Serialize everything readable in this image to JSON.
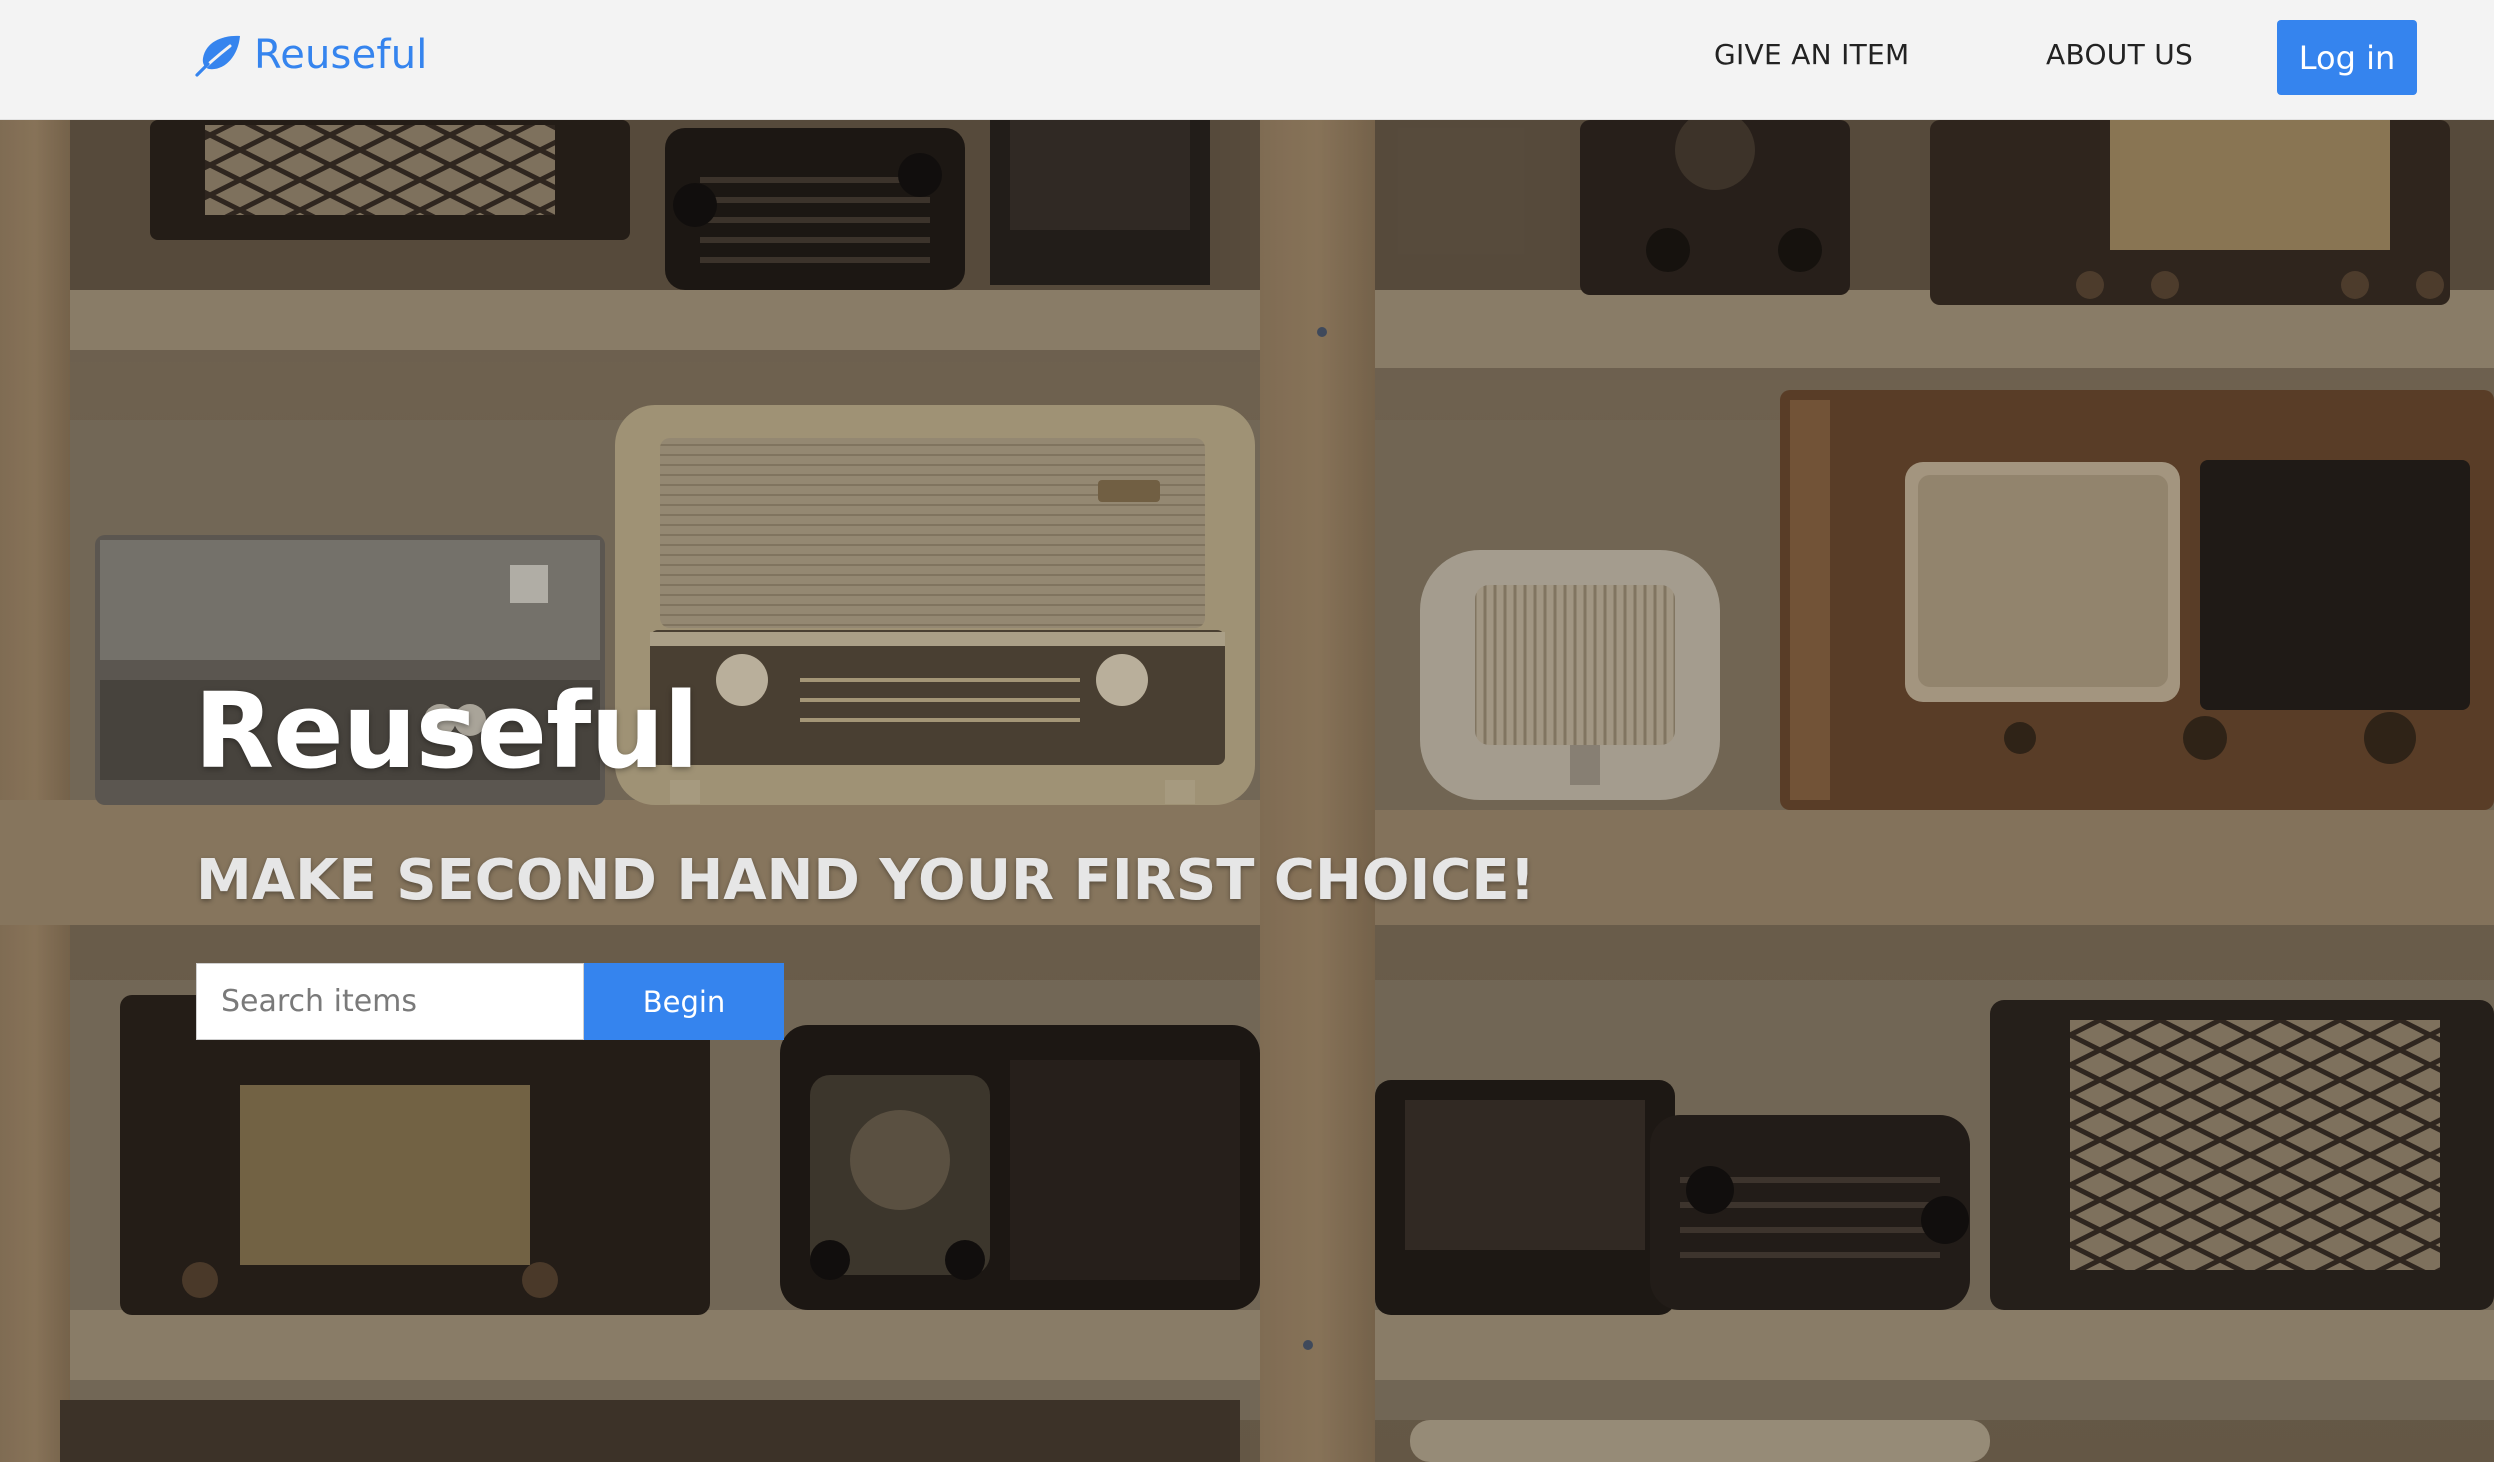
{
  "navbar": {
    "brand": "Reuseful",
    "brand_icon": "leaf-icon",
    "links": [
      "GIVE AN ITEM",
      "ABOUT US"
    ],
    "login_label": "Log in"
  },
  "hero": {
    "title": "Reuseful",
    "subtitle": "MAKE SECOND HAND YOUR FIRST CHOICE!",
    "search_placeholder": "Search items",
    "search_value": "",
    "begin_label": "Begin"
  },
  "colors": {
    "accent": "#3584ee",
    "navbar_bg": "#f3f3f3"
  }
}
